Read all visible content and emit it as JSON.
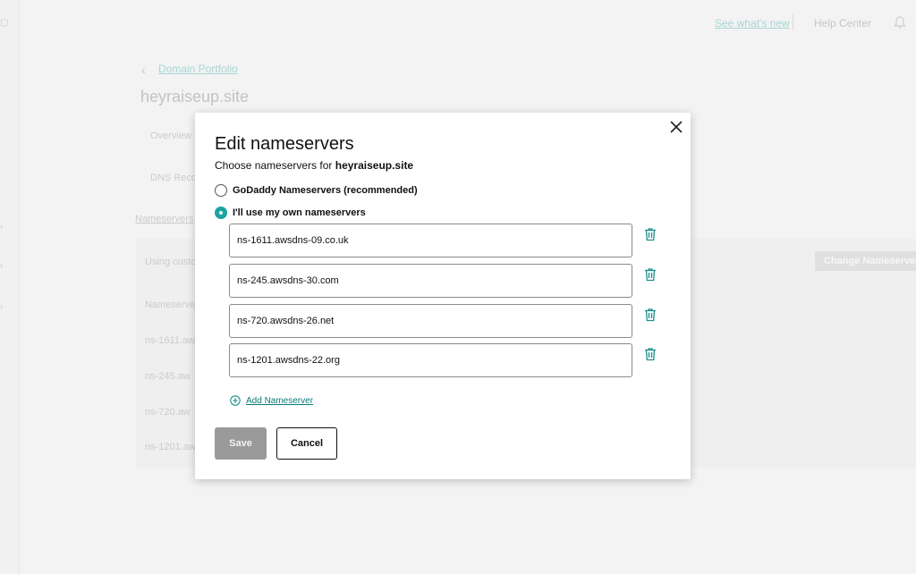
{
  "background": {
    "header": {
      "whats_new": "See what's new",
      "help_center": "Help Center"
    },
    "breadcrumb": "Domain Portfolio",
    "domain_title": "heyraiseup.site",
    "tab_overview": "Overview",
    "tab_dns": "DNS Reco",
    "nameservers_link": "Nameservers",
    "using_custom": "Using custo",
    "change_button": "Change Nameservers",
    "ns_header": "Nameserve",
    "ns_rows": [
      "ns-1611.aw",
      "ns-245.aw",
      "ns-720.aw",
      "ns-1201.aw"
    ]
  },
  "modal": {
    "title": "Edit nameservers",
    "subtitle_prefix": "Choose nameservers for ",
    "subtitle_domain": "heyraiseup.site",
    "options": [
      {
        "label": "GoDaddy Nameservers (recommended)",
        "selected": false
      },
      {
        "label": "I'll use my own nameservers",
        "selected": true
      }
    ],
    "nameservers": [
      "ns-1611.awsdns-09.co.uk",
      "ns-245.awsdns-30.com",
      "ns-720.awsdns-26.net",
      "ns-1201.awsdns-22.org"
    ],
    "add_label": "Add Nameserver",
    "save_label": "Save",
    "cancel_label": "Cancel"
  },
  "colors": {
    "accent": "#1ba5a0",
    "link": "#0a7a77",
    "save_disabled": "#9a9a9a"
  }
}
